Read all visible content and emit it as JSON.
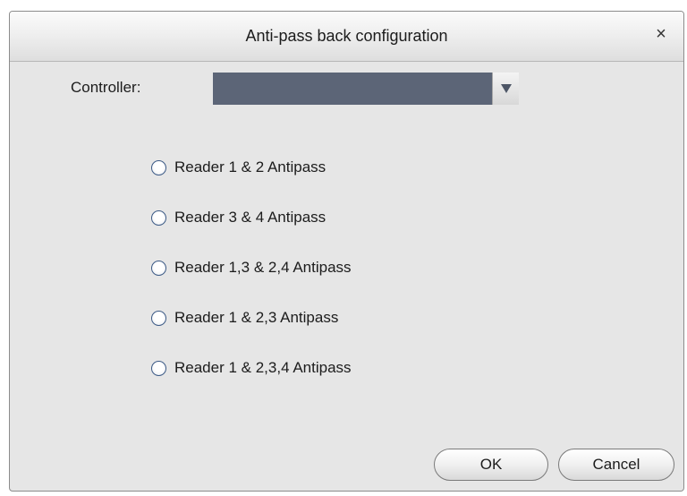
{
  "dialog": {
    "title": "Anti-pass back configuration",
    "close_label": "×"
  },
  "controller": {
    "label": "Controller:",
    "selected_value": "",
    "arrow_icon": "triangle-down-icon"
  },
  "options": [
    {
      "label": "Reader 1 & 2 Antipass",
      "selected": false
    },
    {
      "label": "Reader 3 & 4 Antipass",
      "selected": false
    },
    {
      "label": "Reader 1,3 & 2,4 Antipass",
      "selected": false
    },
    {
      "label": "Reader 1 & 2,3 Antipass",
      "selected": false
    },
    {
      "label": "Reader 1 & 2,3,4 Antipass",
      "selected": false
    }
  ],
  "buttons": {
    "ok": "OK",
    "cancel": "Cancel"
  },
  "colors": {
    "select_fill": "#5c6577",
    "radio_border": "#3c5a86",
    "dialog_bg": "#e6e6e6"
  }
}
